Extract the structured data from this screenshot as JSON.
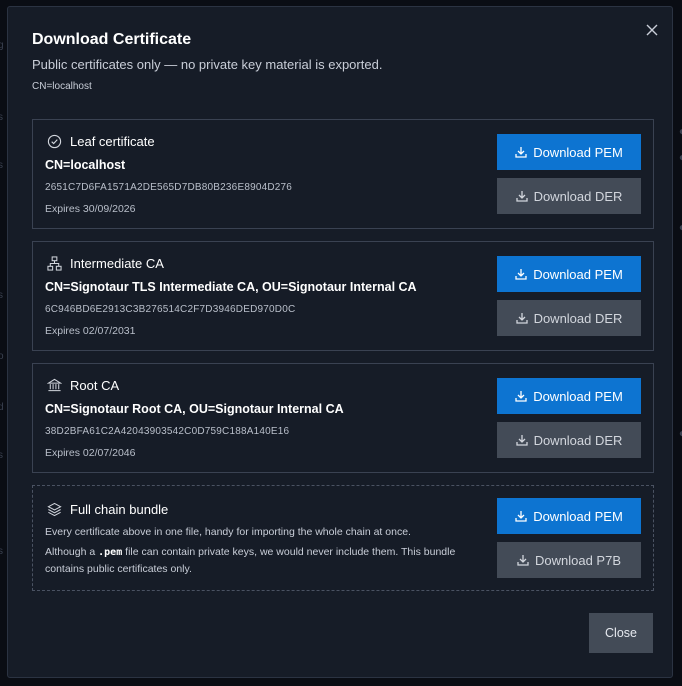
{
  "dialog": {
    "title": "Download Certificate",
    "subtitle": "Public certificates only — no private key material is exported.",
    "cn": "CN=localhost",
    "close_label": "Close"
  },
  "certificates": [
    {
      "name": "Leaf certificate",
      "icon": "check-circle-icon",
      "cn": "CN=localhost",
      "serial": "2651C7D6FA1571A2DE565D7DB80B236E8904D276",
      "expires": "Expires 30/09/2026",
      "primary_label": "Download PEM",
      "secondary_label": "Download DER"
    },
    {
      "name": "Intermediate CA",
      "icon": "hierarchy-icon",
      "cn": "CN=Signotaur TLS Intermediate CA, OU=Signotaur Internal CA",
      "serial": "6C946BD6E2913C3B276514C2F7D3946DED970D0C",
      "expires": "Expires 02/07/2031",
      "primary_label": "Download PEM",
      "secondary_label": "Download DER"
    },
    {
      "name": "Root CA",
      "icon": "bank-icon",
      "cn": "CN=Signotaur Root CA, OU=Signotaur Internal CA",
      "serial": "38D2BFA61C2A42043903542C0D759C188A140E16",
      "expires": "Expires 02/07/2046",
      "primary_label": "Download PEM",
      "secondary_label": "Download DER"
    }
  ],
  "bundle": {
    "name": "Full chain bundle",
    "icon": "layers-icon",
    "line1": "Every certificate above in one file, handy for importing the whole chain at once.",
    "line2_prefix": "Although a ",
    "line2_code": ".pem",
    "line2_suffix": " file can contain private keys, we would never include them. This bundle contains public certificates only.",
    "primary_label": "Download PEM",
    "secondary_label": "Download P7B"
  },
  "colors": {
    "primary": "#0d74d1",
    "secondary": "#434b57",
    "dialog_bg": "#161c27"
  }
}
